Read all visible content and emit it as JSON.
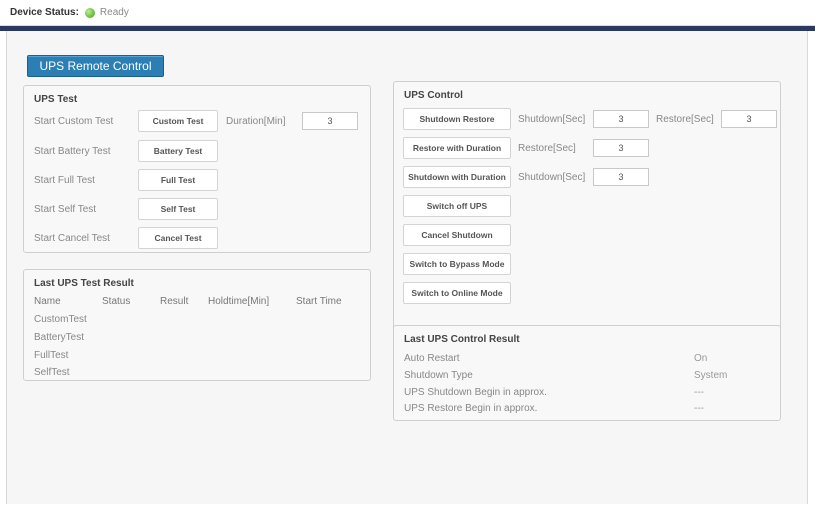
{
  "status": {
    "label": "Device Status:",
    "value": "Ready",
    "dot_color": "#3d9d1a"
  },
  "header": {
    "title": "UPS Remote Control"
  },
  "ups_test": {
    "title": "UPS Test",
    "rows": [
      {
        "label": "Start Custom Test",
        "button": "Custom Test"
      },
      {
        "label": "Start Battery Test",
        "button": "Battery Test"
      },
      {
        "label": "Start Full Test",
        "button": "Full Test"
      },
      {
        "label": "Start Self Test",
        "button": "Self Test"
      },
      {
        "label": "Start Cancel Test",
        "button": "Cancel Test"
      }
    ],
    "duration_label": "Duration[Min]",
    "duration_value": "3"
  },
  "last_test": {
    "title": "Last UPS Test Result",
    "columns": [
      "Name",
      "Status",
      "Result",
      "Holdtime[Min]",
      "Start Time"
    ],
    "rows": [
      "CustomTest",
      "BatteryTest",
      "FullTest",
      "SelfTest"
    ]
  },
  "ups_control": {
    "title": "UPS Control",
    "buttons": [
      "Shutdown Restore",
      "Restore with Duration",
      "Shutdown with Duration",
      "Switch off UPS",
      "Cancel Shutdown",
      "Switch to Bypass Mode",
      "Switch to Online Mode"
    ],
    "shutdown_sec_label": "Shutdown[Sec]",
    "restore_sec_label": "Restore[Sec]",
    "sr_shutdown_value": "3",
    "sr_restore_value": "3",
    "rwd_restore_value": "3",
    "swd_shutdown_value": "3"
  },
  "last_control": {
    "title": "Last UPS Control Result",
    "rows": [
      {
        "label": "Auto Restart",
        "value": "On"
      },
      {
        "label": "Shutdown Type",
        "value": "System"
      },
      {
        "label": "UPS Shutdown Begin in approx.",
        "value": "---"
      },
      {
        "label": "UPS Restore Begin in approx.",
        "value": "---"
      }
    ]
  }
}
